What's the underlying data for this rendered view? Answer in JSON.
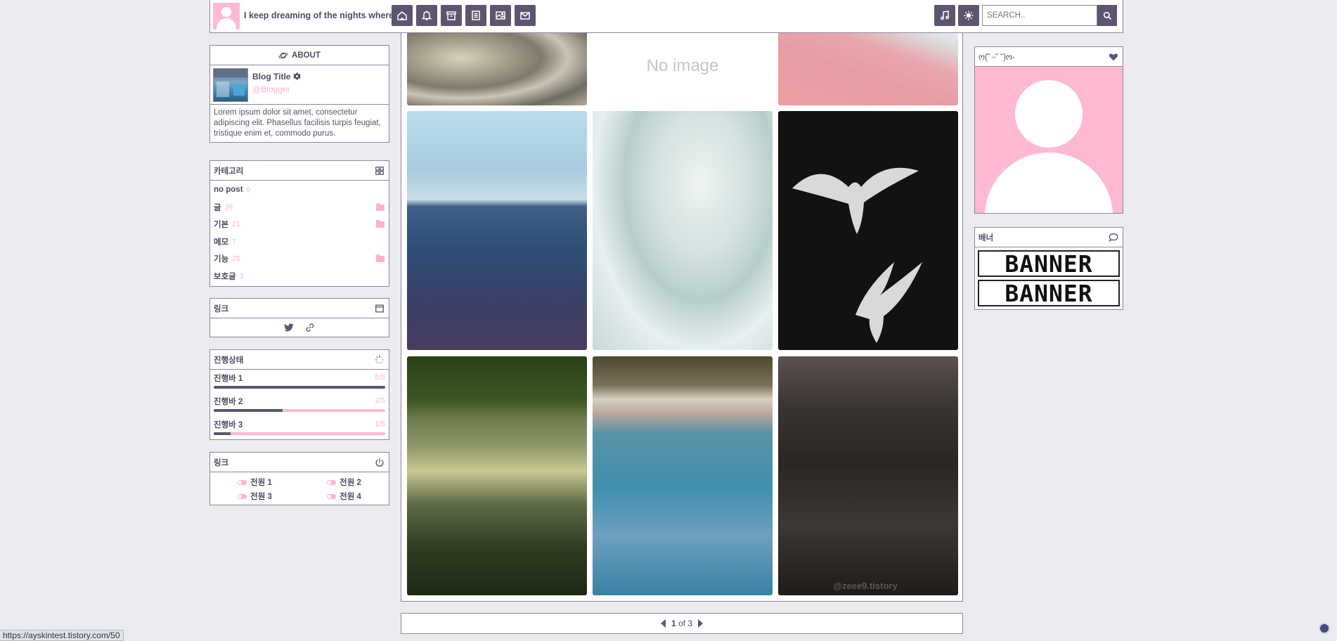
{
  "header": {
    "site_title": "I keep dreaming of the nights where.",
    "nav_icons": [
      "home-icon",
      "bell-icon",
      "archive-icon",
      "document-icon",
      "image-icon",
      "mail-icon"
    ],
    "right_icons": [
      "music-icon",
      "sun-icon"
    ],
    "search_placeholder": "SEARCH..",
    "search_icon": "magnifier-icon"
  },
  "about": {
    "heading": "ABOUT",
    "blog_title": "Blog Title",
    "blogger": "@Blogger",
    "description": "Lorem ipsum dolor sit amet, consectetur adipiscing elit. Phasellus facilisis turpis feugiat, tristique enim et, commodo purus."
  },
  "category": {
    "heading": "카테고리",
    "items": [
      {
        "label": "no post",
        "count": "0",
        "folder": false
      },
      {
        "label": "글",
        "count": "26",
        "folder": true
      },
      {
        "label": "기본",
        "count": "21",
        "folder": true
      },
      {
        "label": "메모",
        "count": "7",
        "folder": false
      },
      {
        "label": "기능",
        "count": "25",
        "folder": true
      },
      {
        "label": "보호글",
        "count": "3",
        "folder": false
      }
    ]
  },
  "links": {
    "heading": "링크",
    "icons": [
      "twitter-icon",
      "link-icon"
    ]
  },
  "progress": {
    "heading": "진행상태",
    "bars": [
      {
        "label": "진행바 1",
        "value": "5/5",
        "fraction": 1.0
      },
      {
        "label": "진행바 2",
        "value": "2/5",
        "fraction": 0.4
      },
      {
        "label": "진행바 3",
        "value": "1/5",
        "fraction": 0.1
      }
    ]
  },
  "power": {
    "heading": "링크",
    "items": [
      "전원 1",
      "전원 2",
      "전원 3",
      "전원 4"
    ]
  },
  "gallery": {
    "no_image_text": "No image",
    "watermark": "@zeee9.tistory"
  },
  "pager": {
    "current": "1",
    "total_text": "of 3"
  },
  "profile": {
    "heading": "ო(˘ ᵕ˘ ˘)ო-"
  },
  "banner": {
    "heading": "배너",
    "items": [
      "BANNER",
      "BANNER"
    ]
  },
  "status_bar": {
    "url": "https://ayskintest.tistory.com/50"
  },
  "colors": {
    "accent": "#5d5570",
    "pink": "#ffb9d0",
    "border": "#8e86a0",
    "background": "#ecebef"
  }
}
